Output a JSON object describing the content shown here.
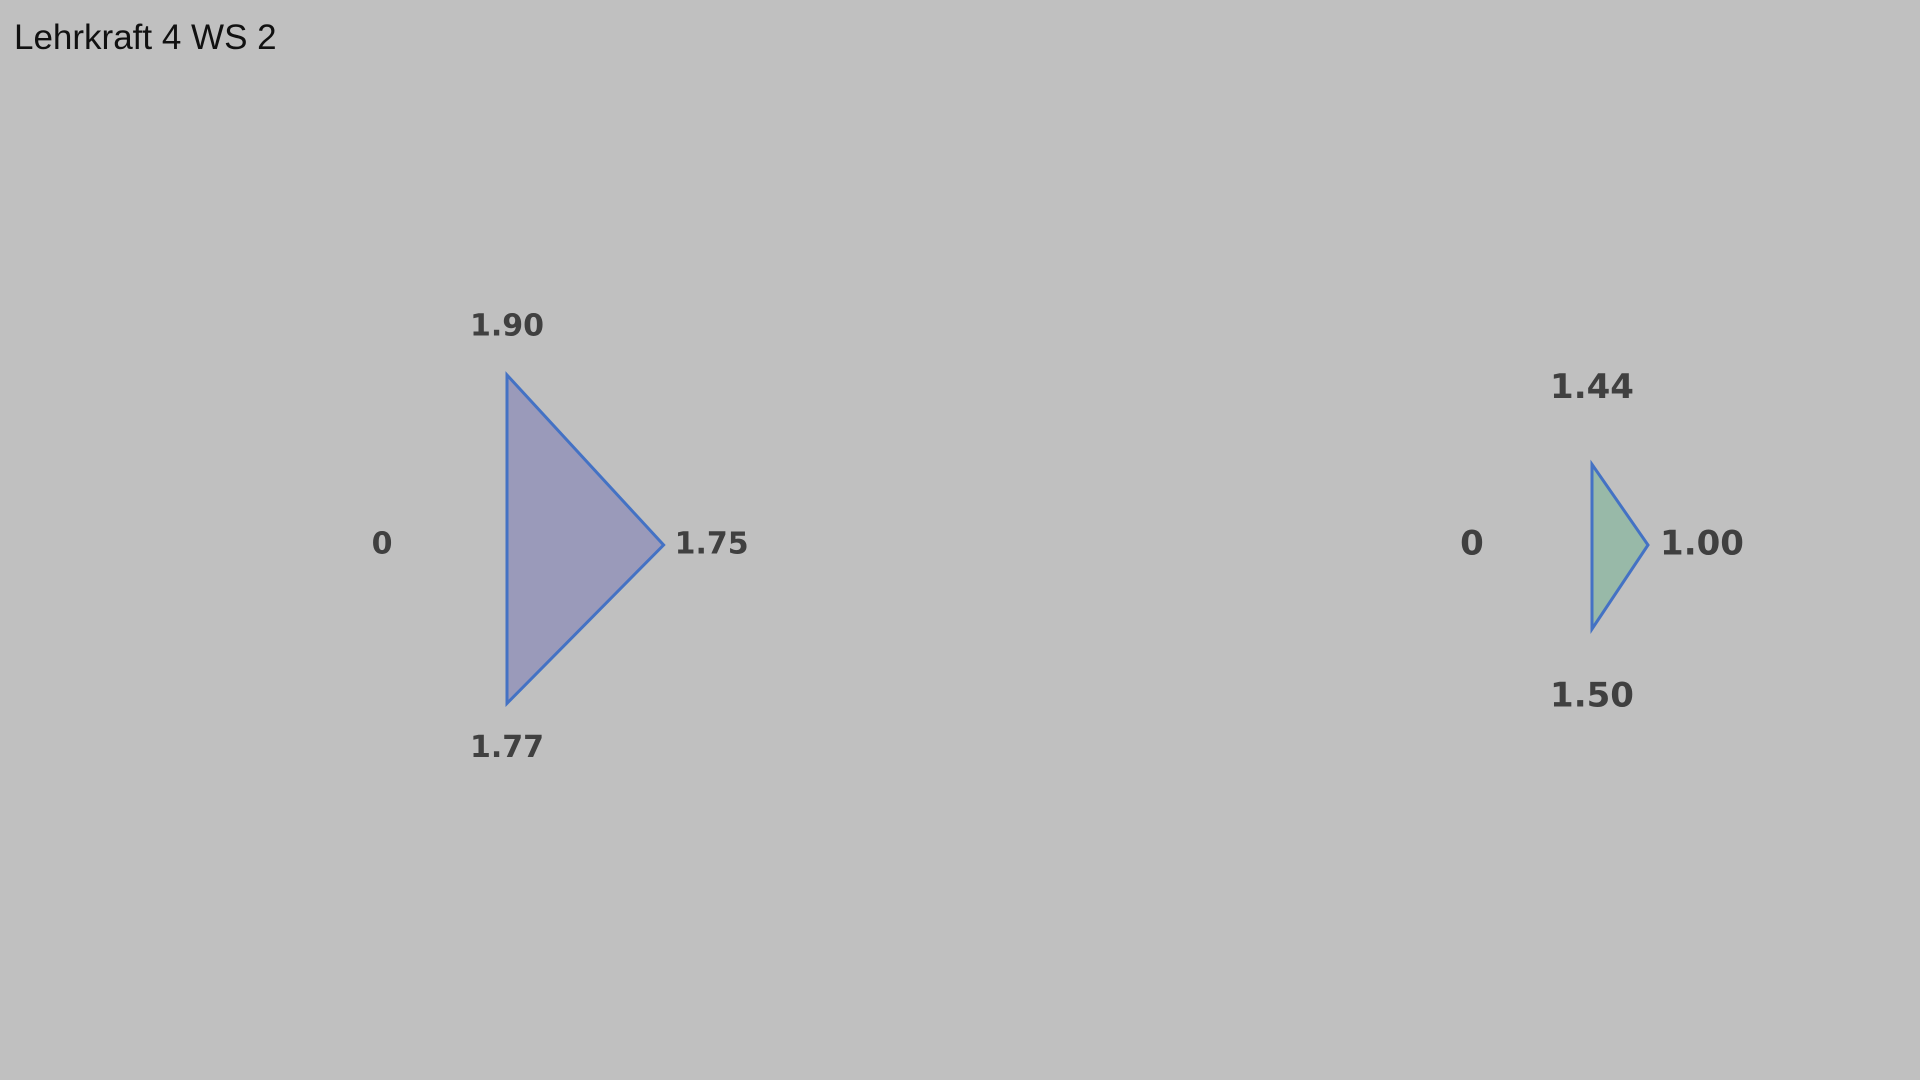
{
  "title": "Lehrkraft 4 WS 2",
  "chart_data": [
    {
      "type": "radar",
      "axes": [
        "top",
        "right",
        "bottom",
        "left"
      ],
      "values": [
        1.9,
        1.75,
        1.77,
        0
      ],
      "labels": [
        "1.90",
        "1.75",
        "1.77",
        "0"
      ],
      "fill_color": "#9a9aba",
      "stroke_color": "#4472c4"
    },
    {
      "type": "radar",
      "axes": [
        "top",
        "right",
        "bottom",
        "left"
      ],
      "values": [
        1.44,
        1.0,
        1.5,
        0
      ],
      "labels": [
        "1.44",
        "1.00",
        "1.50",
        "0"
      ],
      "fill_color": "#98b9a8",
      "stroke_color": "#4472c4"
    }
  ]
}
